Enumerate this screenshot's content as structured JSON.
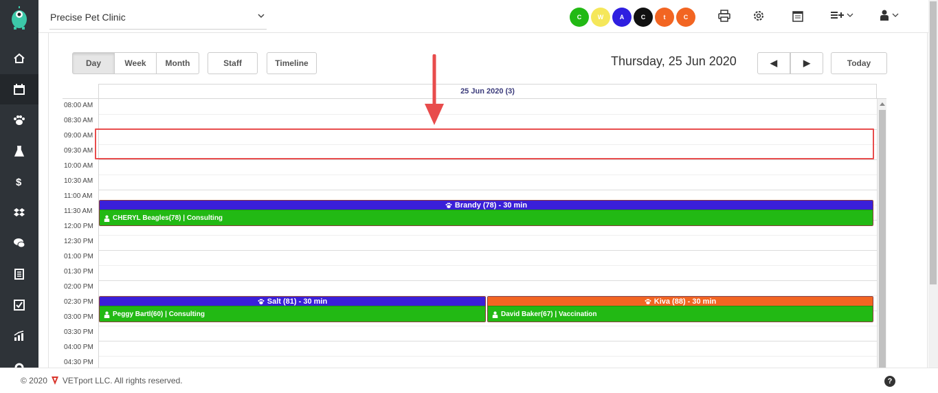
{
  "header": {
    "clinic_name": "Precise Pet Clinic",
    "status_circles": [
      {
        "label": "C",
        "color": "#22b914",
        "text_color": "#ffffff"
      },
      {
        "label": "W",
        "color": "#f5e75a",
        "text_color": "#ffffff"
      },
      {
        "label": "A",
        "color": "#2f1fe0",
        "text_color": "#ffffff"
      },
      {
        "label": "C",
        "color": "#111111",
        "text_color": "#ffffff"
      },
      {
        "label": "t",
        "color": "#f26522",
        "text_color": "#ffffff"
      },
      {
        "label": "C",
        "color": "#f26522",
        "text_color": "#ffffff"
      }
    ],
    "icons": [
      "print-icon",
      "gear-icon",
      "calendar-icon",
      "add-list-icon",
      "user-icon"
    ]
  },
  "sidebar": {
    "items": [
      "home-icon",
      "calendar-icon",
      "paw-icon",
      "flask-icon",
      "dollar-icon",
      "dropbox-icon",
      "chat-icon",
      "report-icon",
      "checkbox-icon",
      "chart-icon",
      "gear-icon"
    ]
  },
  "toolbar": {
    "view_day": "Day",
    "view_week": "Week",
    "view_month": "Month",
    "staff": "Staff",
    "timeline": "Timeline",
    "date_title": "Thursday, 25 Jun 2020",
    "prev": "◀",
    "next": "▶",
    "today": "Today"
  },
  "calendar": {
    "day_header": "25 Jun 2020 (3)",
    "times": [
      "08:00 AM",
      "08:30 AM",
      "09:00 AM",
      "09:30 AM",
      "10:00 AM",
      "10:30 AM",
      "11:00 AM",
      "11:30 AM",
      "12:00 PM",
      "12:30 PM",
      "01:00 PM",
      "01:30 PM",
      "02:00 PM",
      "02:30 PM",
      "03:00 PM",
      "03:30 PM",
      "04:00 PM",
      "04:30 PM"
    ],
    "appointments": [
      {
        "title": "Brandy (78) - 30 min",
        "detail": "CHERYL Beagles(78) | Consulting",
        "top_color": "#3a1fd9"
      },
      {
        "title": "Salt (81) - 30 min",
        "detail": "Peggy Bartl(60) | Consulting",
        "top_color": "#3a1fd9"
      },
      {
        "title": "Kiva (88) - 30 min",
        "detail": "David Baker(67) | Vaccination",
        "top_color": "#f26522"
      }
    ]
  },
  "footer": {
    "copyright": "© 2020",
    "company": "VETport LLC. All rights reserved.",
    "help": "?"
  }
}
